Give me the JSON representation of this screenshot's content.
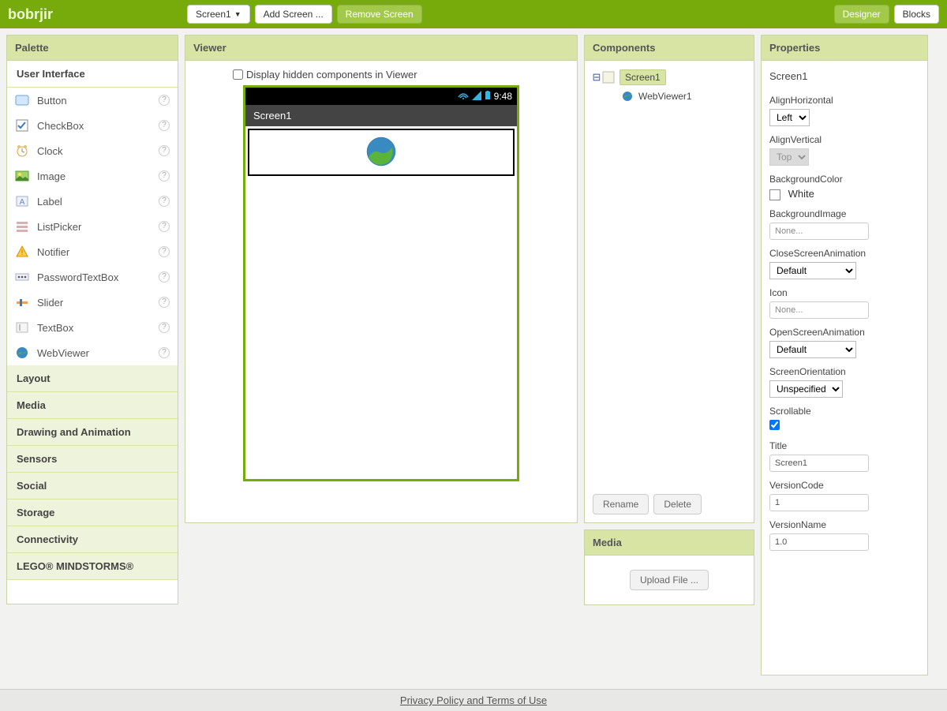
{
  "app": {
    "brand": "bobrjir"
  },
  "topbar": {
    "screen_selector": "Screen1",
    "add_screen": "Add Screen ...",
    "remove_screen": "Remove Screen",
    "designer": "Designer",
    "blocks": "Blocks"
  },
  "palette": {
    "title": "Palette",
    "active_section": "User Interface",
    "items": [
      "Button",
      "CheckBox",
      "Clock",
      "Image",
      "Label",
      "ListPicker",
      "Notifier",
      "PasswordTextBox",
      "Slider",
      "TextBox",
      "WebViewer"
    ],
    "sections": [
      "Layout",
      "Media",
      "Drawing and Animation",
      "Sensors",
      "Social",
      "Storage",
      "Connectivity",
      "LEGO® MINDSTORMS®"
    ]
  },
  "viewer": {
    "title": "Viewer",
    "hidden_label": "Display hidden components in Viewer",
    "phone_time": "9:48",
    "screen_title": "Screen1"
  },
  "components": {
    "title": "Components",
    "root": "Screen1",
    "child": "WebViewer1",
    "rename": "Rename",
    "delete": "Delete"
  },
  "media": {
    "title": "Media",
    "upload": "Upload File ..."
  },
  "properties": {
    "title": "Properties",
    "subject": "Screen1",
    "align_h_label": "AlignHorizontal",
    "align_h_value": "Left",
    "align_v_label": "AlignVertical",
    "align_v_value": "Top",
    "bgcolor_label": "BackgroundColor",
    "bgcolor_value": "White",
    "bgimage_label": "BackgroundImage",
    "bgimage_value": "None...",
    "close_anim_label": "CloseScreenAnimation",
    "close_anim_value": "Default",
    "icon_label": "Icon",
    "icon_value": "None...",
    "open_anim_label": "OpenScreenAnimation",
    "open_anim_value": "Default",
    "orient_label": "ScreenOrientation",
    "orient_value": "Unspecified",
    "scroll_label": "Scrollable",
    "title_label": "Title",
    "title_value": "Screen1",
    "vcode_label": "VersionCode",
    "vcode_value": "1",
    "vname_label": "VersionName",
    "vname_value": "1.0"
  },
  "footer": {
    "link": "Privacy Policy and Terms of Use"
  }
}
